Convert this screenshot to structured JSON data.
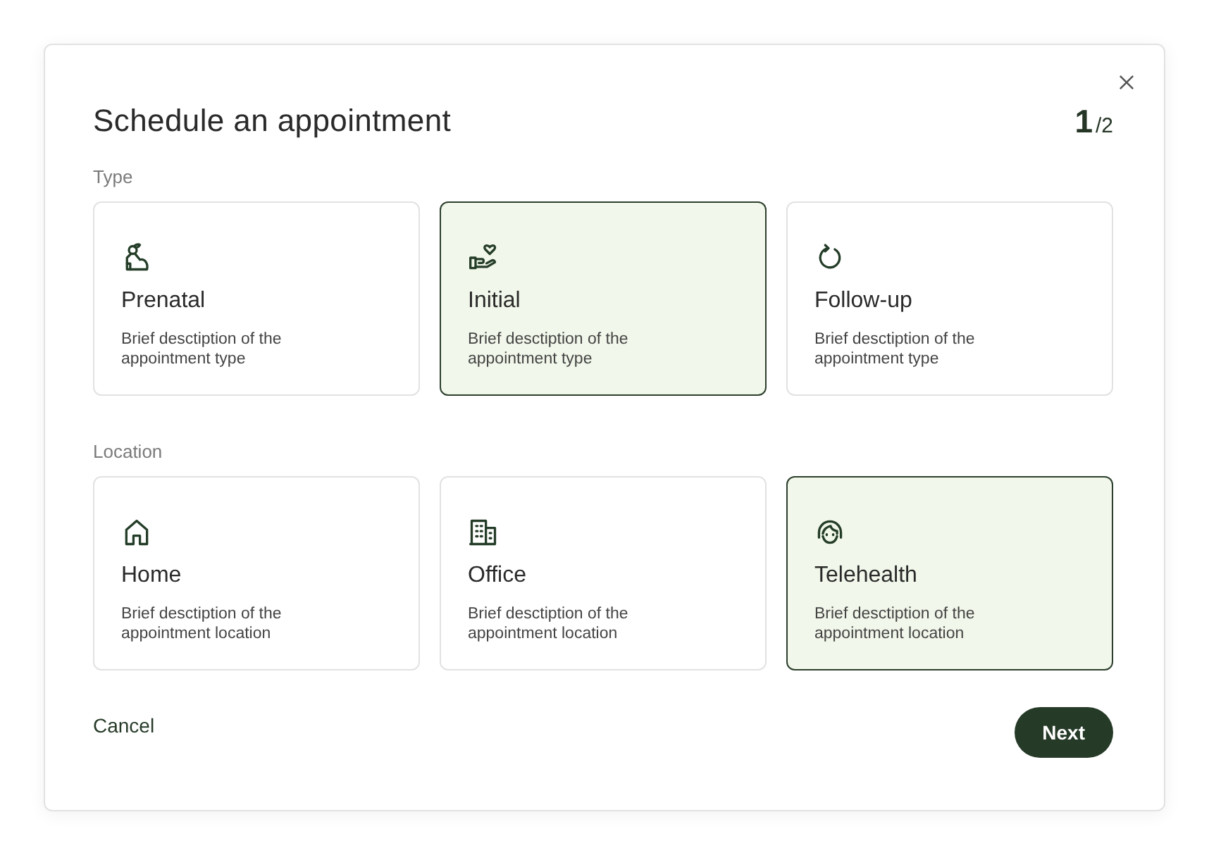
{
  "dialog": {
    "title": "Schedule an appointment",
    "step": {
      "current": "1",
      "of": "/2"
    }
  },
  "sections": [
    {
      "label": "Type",
      "options": [
        {
          "kind": "prenatal",
          "title": "Prenatal",
          "description": "Brief desctiption of the appointment type",
          "selected": false
        },
        {
          "kind": "initial",
          "title": "Initial",
          "description": "Brief desctiption of the appointment type",
          "selected": true
        },
        {
          "kind": "followup",
          "title": "Follow-up",
          "description": "Brief desctiption of the appointment type",
          "selected": false
        }
      ]
    },
    {
      "label": "Location",
      "options": [
        {
          "kind": "home",
          "title": "Home",
          "description": "Brief desctiption of the appointment location",
          "selected": false
        },
        {
          "kind": "office",
          "title": "Office",
          "description": "Brief desctiption of the appointment location",
          "selected": false
        },
        {
          "kind": "telehealth",
          "title": "Telehealth",
          "description": "Brief desctiption of the appointment location",
          "selected": true
        }
      ]
    }
  ],
  "actions": {
    "cancel": "Cancel",
    "next": "Next"
  }
}
